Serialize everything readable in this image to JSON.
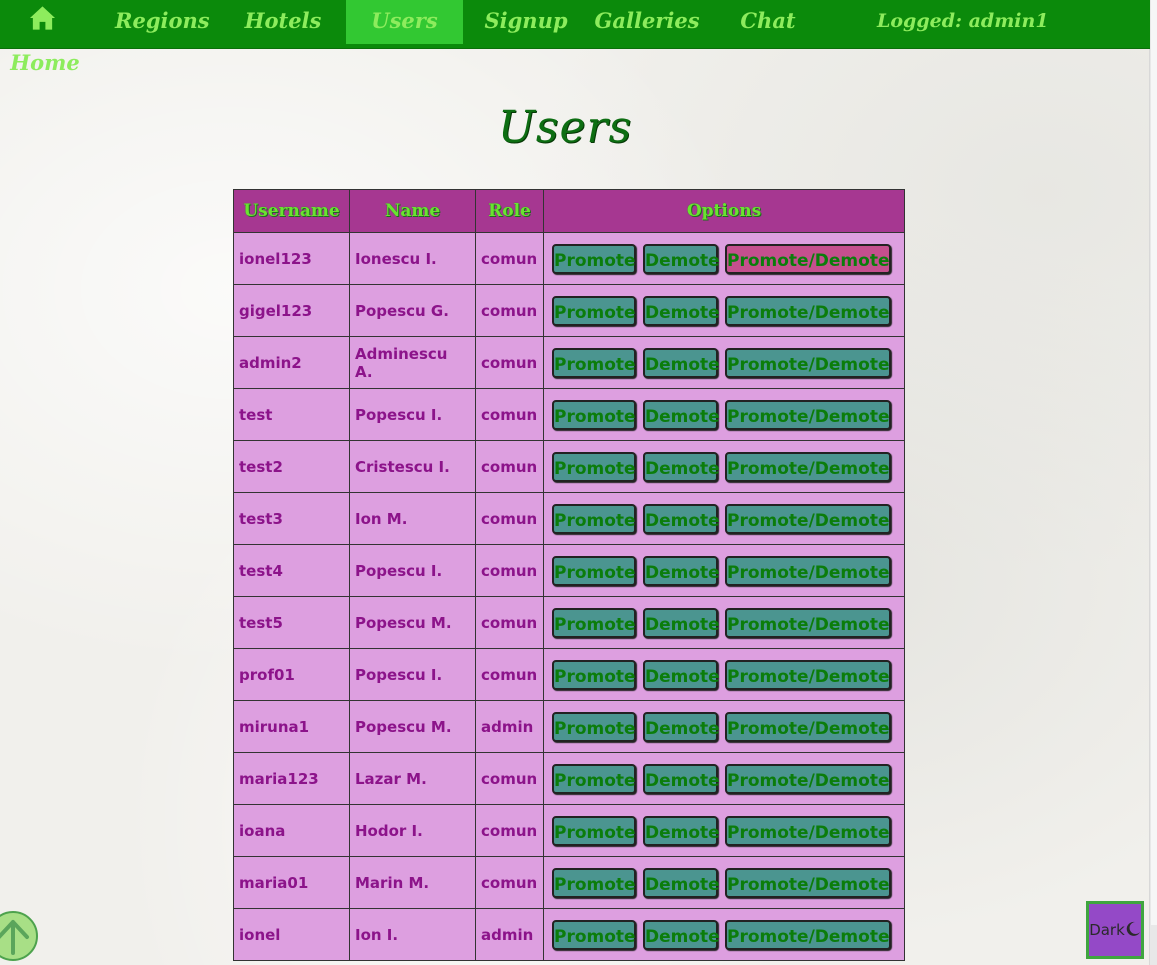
{
  "nav": {
    "items": [
      {
        "label": "Home",
        "icon": "home-icon"
      },
      {
        "label": "Regions"
      },
      {
        "label": "Hotels"
      },
      {
        "label": "Users",
        "active": true
      },
      {
        "label": "Signup"
      },
      {
        "label": "Galleries"
      },
      {
        "label": "Chat"
      }
    ],
    "logged": "Logged: admin1"
  },
  "page": {
    "title": "Users"
  },
  "table": {
    "headers": [
      "Username",
      "Name",
      "Role",
      "Options"
    ],
    "buttons": {
      "promote": "Promote",
      "demote": "Demote",
      "both": "Promote/Demote"
    },
    "rows": [
      {
        "username": "ionel123",
        "name": "Ionescu I.",
        "role": "comun"
      },
      {
        "username": "gigel123",
        "name": "Popescu G.",
        "role": "comun"
      },
      {
        "username": "admin2",
        "name": "Adminescu A.",
        "role": "comun"
      },
      {
        "username": "test",
        "name": "Popescu I.",
        "role": "comun"
      },
      {
        "username": "test2",
        "name": "Cristescu I.",
        "role": "comun"
      },
      {
        "username": "test3",
        "name": "Ion M.",
        "role": "comun"
      },
      {
        "username": "test4",
        "name": "Popescu I.",
        "role": "comun"
      },
      {
        "username": "test5",
        "name": "Popescu M.",
        "role": "comun"
      },
      {
        "username": "prof01",
        "name": "Popescu I.",
        "role": "comun"
      },
      {
        "username": "miruna1",
        "name": "Popescu M.",
        "role": "admin"
      },
      {
        "username": "maria123",
        "name": "Lazar M.",
        "role": "comun"
      },
      {
        "username": "ioana",
        "name": "Hodor I.",
        "role": "comun"
      },
      {
        "username": "maria01",
        "name": "Marin M.",
        "role": "comun"
      },
      {
        "username": "ionel",
        "name": "Ion I.",
        "role": "admin"
      }
    ]
  },
  "dark_toggle": {
    "label": "Dark",
    "icon": "moon-icon"
  },
  "back_to_top": {
    "icon": "arrow-up-icon"
  },
  "colors": {
    "nav": "#0b8a0b",
    "nav_text": "#8dec5d",
    "header": "#a63791",
    "cell": "#dd9fe0",
    "button": "#4b9590",
    "button_hover": "#c54f8e"
  }
}
